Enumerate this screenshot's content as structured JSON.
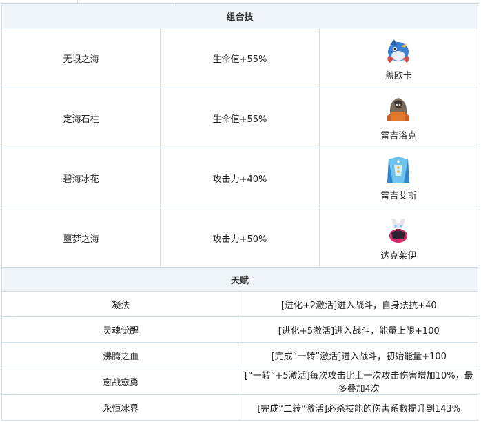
{
  "combo_section": {
    "title": "组合技",
    "rows": [
      {
        "name": "无垠之海",
        "bonus": "生命值+55%",
        "pet": "盖欧卡",
        "icon": "blue-whale-pet-icon"
      },
      {
        "name": "定海石柱",
        "bonus": "生命值+55%",
        "pet": "雷吉洛克",
        "icon": "rock-golem-pet-icon"
      },
      {
        "name": "碧海冰花",
        "bonus": "攻击力+40%",
        "pet": "雷吉艾斯",
        "icon": "ice-golem-pet-icon"
      },
      {
        "name": "噩梦之海",
        "bonus": "攻击力+50%",
        "pet": "达克莱伊",
        "icon": "dark-ghost-pet-icon"
      }
    ]
  },
  "talent_section": {
    "title": "天赋",
    "rows": [
      {
        "name": "凝法",
        "desc": "[进化+2激活]进入战斗，自身法抗+40"
      },
      {
        "name": "灵魂觉醒",
        "desc": "[进化+5激活]进入战斗，能量上限+100"
      },
      {
        "name": "沸腾之血",
        "desc": "[完成“一转”激活]进入战斗，初始能量+100"
      },
      {
        "name": "愈战愈勇",
        "desc": "[“一转”+5激活]每次攻击比上一次攻击伤害增加10%，最多叠加4次"
      },
      {
        "name": "永恒冰界",
        "desc": "[完成“二转”激活]必杀技能的伤害系数提升到143%"
      }
    ]
  },
  "colors": {
    "border": "#cfdde6",
    "header_bg": "#eef4f8"
  }
}
